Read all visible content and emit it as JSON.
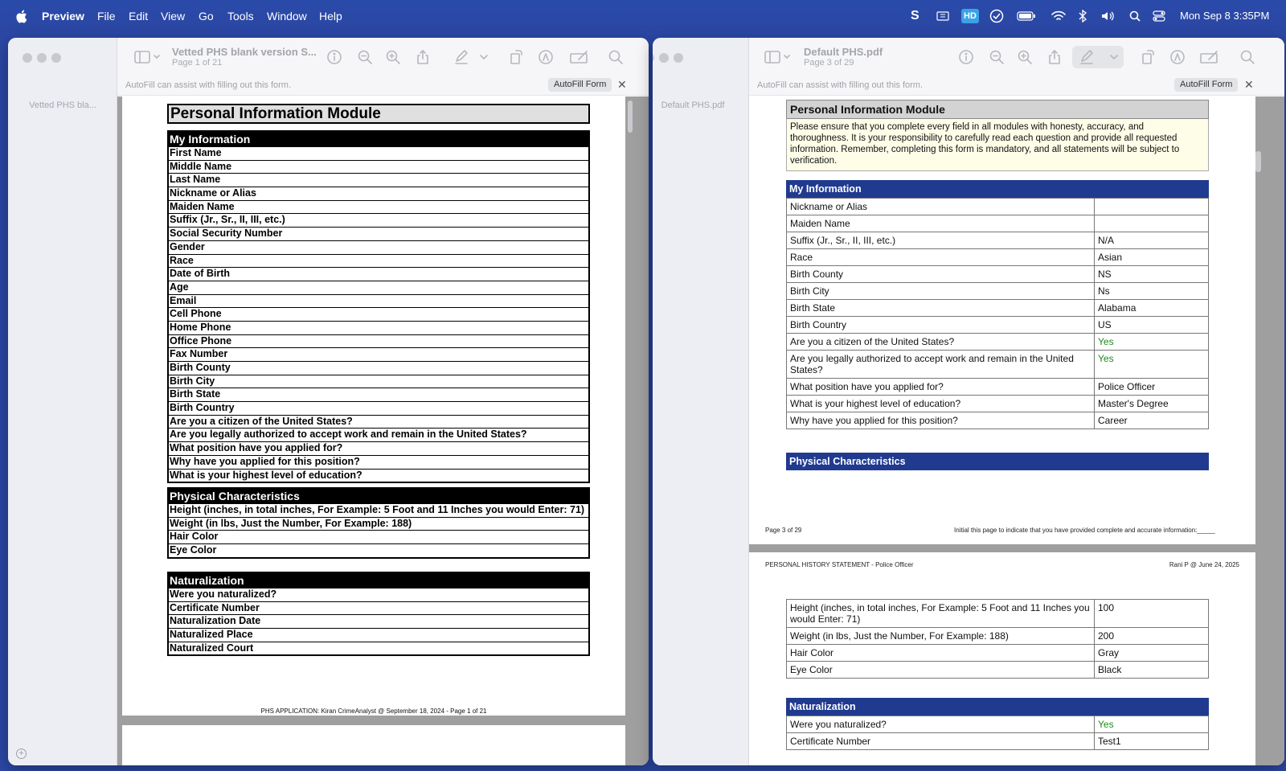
{
  "menubar": {
    "app_name": "Preview",
    "menus": [
      "File",
      "Edit",
      "View",
      "Go",
      "Tools",
      "Window",
      "Help"
    ],
    "status": {
      "hd_badge": "HD",
      "datetime": "Mon Sep 8  3:35PM"
    }
  },
  "left_window": {
    "title": "Vetted PHS blank version S...",
    "subtitle": "Page 1 of 21",
    "sidebar_thumb_label": "Vetted PHS bla...",
    "autofill_text": "AutoFill can assist with filling out this form.",
    "autofill_button": "AutoFill Form",
    "close_glyph": "✕",
    "doc": {
      "title": "Personal Information Module",
      "sections": [
        {
          "heading": "My Information",
          "rows": [
            "First Name",
            "Middle Name",
            "Last Name",
            "Nickname or Alias",
            "Maiden Name",
            "Suffix (Jr., Sr., II, III, etc.)",
            "Social Security Number",
            "Gender",
            "Race",
            "Date of Birth",
            "Age",
            "Email",
            "Cell Phone",
            "Home Phone",
            "Office Phone",
            "Fax Number",
            "Birth County",
            "Birth City",
            "Birth State",
            "Birth Country",
            "Are you a citizen of the United States?",
            "Are you legally authorized to accept work and remain in the United States?",
            "What position have you applied for?",
            "Why have you applied for this position?",
            "What is your highest level of education?"
          ]
        },
        {
          "heading": "Physical Characteristics",
          "rows": [
            "Height (inches, in total inches, For Example: 5 Foot and 11 Inches you would Enter: 71)",
            "Weight (in lbs, Just the Number, For Example: 188)",
            "Hair Color",
            "Eye Color"
          ]
        },
        {
          "heading": "Naturalization",
          "rows": [
            "Were you naturalized?",
            "Certificate Number",
            "Naturalization Date",
            "Naturalized Place",
            "Naturalized Court"
          ]
        }
      ],
      "footer": "PHS APPLICATION: Kiran CrimeAnalyst @ September 18, 2024 - Page 1 of 21"
    }
  },
  "right_window": {
    "title": "Default PHS.pdf",
    "subtitle": "Page 3 of 29",
    "sidebar_thumb_label": "Default PHS.pdf",
    "autofill_text": "AutoFill can assist with filling out this form.",
    "autofill_button": "AutoFill Form",
    "close_glyph": "✕",
    "doc": {
      "title": "Personal Information Module",
      "note": "Please ensure that you complete every field in all modules with honesty, accuracy, and thoroughness. It is your responsibility to carefully read each question and provide all requested information. Remember, completing this form is mandatory, and all statements will be subject to verification.",
      "my_info_heading": "My Information",
      "my_info_rows": [
        {
          "q": "Nickname or Alias",
          "a": ""
        },
        {
          "q": "Maiden Name",
          "a": ""
        },
        {
          "q": "Suffix (Jr., Sr., II, III, etc.)",
          "a": "N/A"
        },
        {
          "q": "Race",
          "a": "Asian"
        },
        {
          "q": "Birth County",
          "a": "NS"
        },
        {
          "q": "Birth City",
          "a": "Ns"
        },
        {
          "q": "Birth State",
          "a": "Alabama"
        },
        {
          "q": "Birth Country",
          "a": "US"
        },
        {
          "q": "Are you a citizen of the United States?",
          "a": "Yes",
          "green": true
        },
        {
          "q": "Are you legally authorized to accept work and remain in the United States?",
          "a": "Yes",
          "green": true
        },
        {
          "q": "What position have you applied for?",
          "a": "Police Officer"
        },
        {
          "q": "What is your highest level of education?",
          "a": "Master's Degree"
        },
        {
          "q": "Why have you applied for this position?",
          "a": "Career"
        }
      ],
      "physical_heading": "Physical Characteristics",
      "page_footer_left": "Page 3 of 29",
      "page_footer_right": "Initial this page to indicate that you have provided complete and accurate information:_____",
      "page4_header_left": "PERSONAL HISTORY STATEMENT - Police Officer",
      "page4_header_right": "Rani P @ June 24, 2025",
      "physical_rows": [
        {
          "q": "Height (inches, in total inches, For Example: 5 Foot and 11 Inches you would Enter: 71)",
          "a": "100"
        },
        {
          "q": "Weight (in lbs, Just the Number, For Example: 188)",
          "a": "200"
        },
        {
          "q": "Hair Color",
          "a": "Gray"
        },
        {
          "q": "Eye Color",
          "a": "Black"
        }
      ],
      "naturalization_heading": "Naturalization",
      "naturalization_rows": [
        {
          "q": "Were you naturalized?",
          "a": "Yes",
          "green": true
        },
        {
          "q": "Certificate Number",
          "a": "Test1"
        }
      ]
    }
  }
}
